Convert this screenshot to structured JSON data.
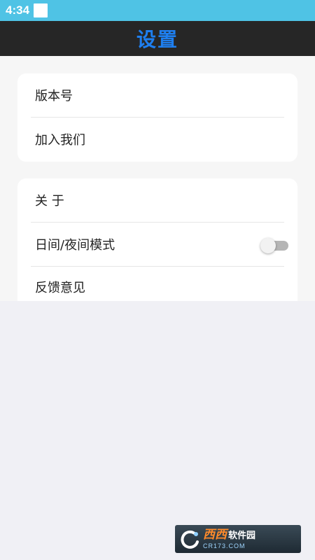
{
  "status_bar": {
    "time": "4:34",
    "color": "#4fc3e5"
  },
  "header": {
    "title": "设置",
    "title_color": "#1e7ff0",
    "background": "#262626"
  },
  "settings": {
    "group1": [
      {
        "label": "版本号"
      },
      {
        "label": "加入我们"
      }
    ],
    "group2": [
      {
        "label": "关 于"
      },
      {
        "label": "日间/夜间模式",
        "toggle": {
          "on": false
        }
      },
      {
        "label": "反馈意见"
      }
    ]
  },
  "watermark": {
    "brand": "西西",
    "suffix": "软件园",
    "domain": "CR173.COM"
  }
}
